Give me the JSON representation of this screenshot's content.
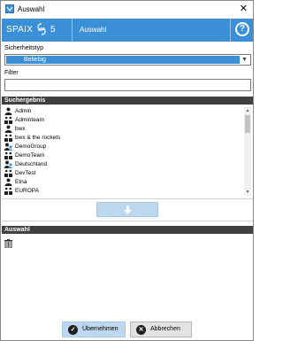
{
  "window": {
    "title": "Auswahl",
    "close_glyph": "✕"
  },
  "header": {
    "logo_text": "SPAIX",
    "logo_number": "5",
    "title": "Auswahl",
    "help_glyph": "?",
    "color": "#3a8fd6"
  },
  "security_type": {
    "label": "Sicherheitstyp",
    "selected": "Beliebig"
  },
  "filter": {
    "label": "Filter",
    "value": ""
  },
  "results": {
    "heading": "Suchergebnis",
    "items": [
      {
        "label": "Admin",
        "icon": "user-icon"
      },
      {
        "label": "Adminteam",
        "icon": "group-icon"
      },
      {
        "label": "bwx",
        "icon": "user-icon"
      },
      {
        "label": "bwx & the rockets",
        "icon": "group-icon"
      },
      {
        "label": "DemoGroup",
        "icon": "role-group-icon"
      },
      {
        "label": "DemoTeam",
        "icon": "group-icon"
      },
      {
        "label": "Deutschland",
        "icon": "role-group-icon"
      },
      {
        "label": "DevTest",
        "icon": "group-icon"
      },
      {
        "label": "Etna",
        "icon": "user-icon"
      },
      {
        "label": "EUROPA",
        "icon": "group-icon"
      }
    ]
  },
  "selection": {
    "heading": "Auswahl"
  },
  "buttons": {
    "ok": "Übernehmen",
    "cancel": "Abbrechen"
  }
}
